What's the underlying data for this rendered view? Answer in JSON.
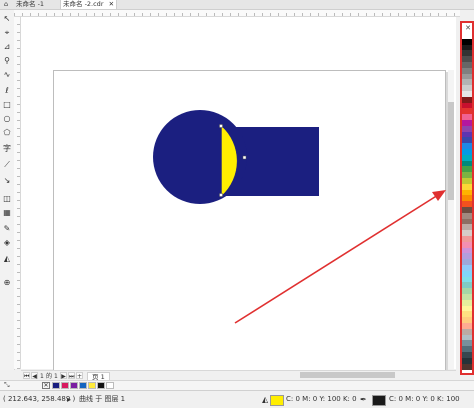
{
  "tabs": [
    {
      "label": "未命名 -1"
    },
    {
      "label": "未命名 -2.cdr"
    }
  ],
  "tools": [
    {
      "icon": "pick-tool-icon",
      "glyph": "↖"
    },
    {
      "icon": "shape-tool-icon",
      "glyph": "⌖"
    },
    {
      "icon": "crop-tool-icon",
      "glyph": "⊿"
    },
    {
      "icon": "zoom-tool-icon",
      "glyph": "⚲"
    },
    {
      "icon": "freehand-tool-icon",
      "glyph": "∿"
    },
    {
      "icon": "smart-draw-tool-icon",
      "glyph": "ℓ"
    },
    {
      "icon": "rectangle-tool-icon",
      "glyph": "□"
    },
    {
      "icon": "ellipse-tool-icon",
      "glyph": "○"
    },
    {
      "icon": "polygon-tool-icon",
      "glyph": "⬠"
    },
    {
      "icon": "text-tool-icon",
      "glyph": "字"
    },
    {
      "icon": "parallel-dimension-tool-icon",
      "glyph": "⟋"
    },
    {
      "icon": "connector-tool-icon",
      "glyph": "↘"
    },
    {
      "icon": "drop-shadow-tool-icon",
      "glyph": "◫"
    },
    {
      "icon": "transparency-tool-icon",
      "glyph": "▦"
    },
    {
      "icon": "eyedropper-tool-icon",
      "glyph": "✎"
    },
    {
      "icon": "interactive-fill-tool-icon",
      "glyph": "◈"
    },
    {
      "icon": "smart-fill-tool-icon",
      "glyph": "◭"
    },
    {
      "icon": "add-tool-icon",
      "glyph": "⊕"
    }
  ],
  "page_nav": {
    "first": "⏮",
    "prev": "◀",
    "page_count": "1",
    "of": "的",
    "total": "1",
    "next": "▶",
    "last": "⏭",
    "add": "+",
    "page_tab": "页 1"
  },
  "palette_colors": [
    "#ffffff",
    "#000000",
    "#1a1a1a",
    "#333333",
    "#4d4d4d",
    "#666666",
    "#808080",
    "#999999",
    "#b3b3b3",
    "#cccccc",
    "#e6e6e6",
    "#7f1a1a",
    "#c8102e",
    "#e3342f",
    "#f06292",
    "#b5179e",
    "#8e44ad",
    "#5e35b1",
    "#3949ab",
    "#1e88e5",
    "#039be5",
    "#00acc1",
    "#00897b",
    "#43a047",
    "#7cb342",
    "#c0ca33",
    "#fdd835",
    "#ffb300",
    "#fb8c00",
    "#f4511e",
    "#6d4c41",
    "#a1887f",
    "#8d6e63",
    "#bcaaa4",
    "#d7ccc8",
    "#ef9a9a",
    "#f48fb1",
    "#ce93d8",
    "#b39ddb",
    "#9fa8da",
    "#90caf9",
    "#81d4fa",
    "#80deea",
    "#80cbc4",
    "#a5d6a7",
    "#c5e1a5",
    "#e6ee9c",
    "#fff59d",
    "#ffe082",
    "#ffcc80",
    "#ffab91",
    "#bcaaa4",
    "#b0bec5",
    "#78909c",
    "#546e7a",
    "#37474f",
    "#263238",
    "#4e342e"
  ],
  "doc_palette": [
    "#1b1f80",
    "#d81b60",
    "#7b1fa2",
    "#1565c0",
    "#ffeb3b",
    "#111111",
    "#ffffff"
  ],
  "status": {
    "coords": "( 212.643, 258.489 )",
    "layer_info": "曲线 于 图层 1",
    "fill_info": "C: 0 M: 0 Y: 100 K: 0",
    "fill_color": "#ffee00",
    "outline_info": "C: 0 M: 0 Y: 0 K: 100",
    "outline_color": "#1a1a1a"
  },
  "colors": {
    "shape_blue": "#1b1f80",
    "shape_yellow": "#ffee00",
    "arrow_red": "#e03030"
  }
}
